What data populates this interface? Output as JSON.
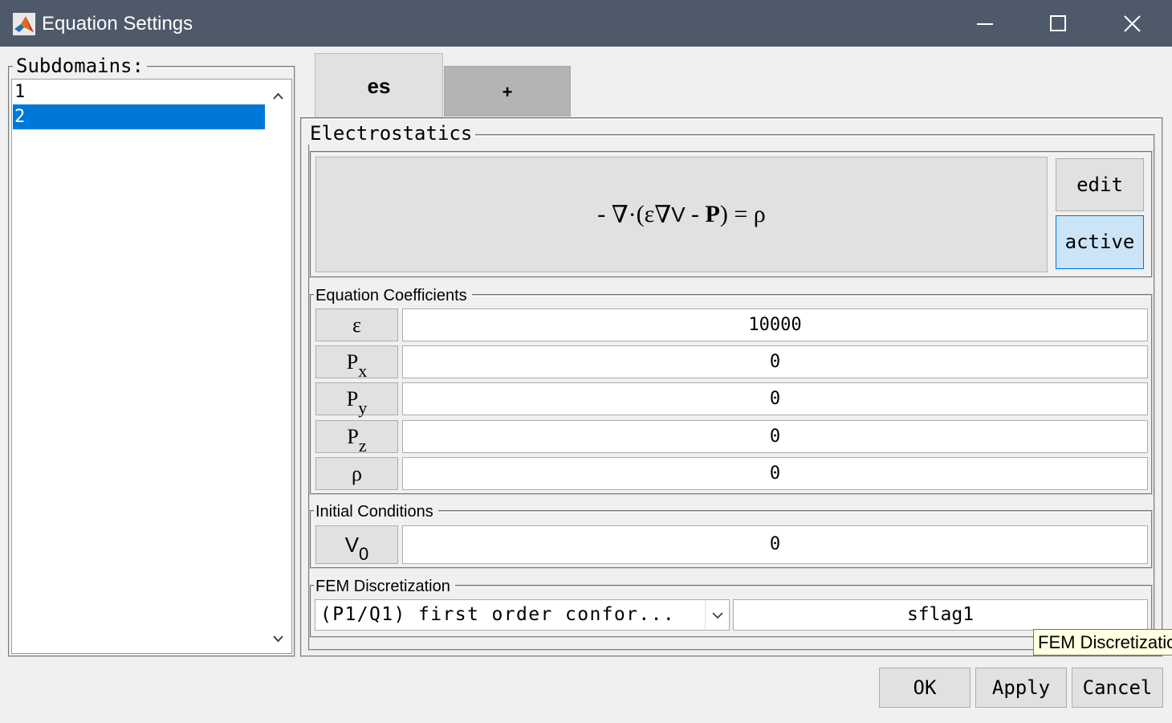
{
  "window": {
    "title": "Equation Settings",
    "icon": "matlab-logo-icon",
    "controls": [
      "minimize-icon",
      "maximize-icon",
      "close-icon"
    ]
  },
  "subdomains": {
    "label": "Subdomains:",
    "items": [
      "1",
      "2"
    ],
    "selected": "2"
  },
  "tabs": [
    {
      "label": "es",
      "active": true
    },
    {
      "label": "+",
      "active": false
    }
  ],
  "physics": {
    "label": "Electrostatics",
    "equation": {
      "minus": "-",
      "div": "∇·",
      "open": "(",
      "eps": "ε",
      "grad": "∇",
      "V": "V",
      "minus2": " - ",
      "P": "P",
      "close": ")",
      "equals": " = ",
      "rho": "ρ"
    },
    "edit_label": "edit",
    "active_label": "active"
  },
  "coefficients": {
    "label": "Equation Coefficients",
    "rows": [
      {
        "symbol": "ε",
        "sub": "",
        "value": "10000"
      },
      {
        "symbol": "P",
        "sub": "x",
        "value": "0"
      },
      {
        "symbol": "P",
        "sub": "y",
        "value": "0"
      },
      {
        "symbol": "P",
        "sub": "z",
        "value": "0"
      },
      {
        "symbol": "ρ",
        "sub": "",
        "value": "0"
      }
    ]
  },
  "initial_conditions": {
    "label": "Initial Conditions",
    "rows": [
      {
        "symbol": "V",
        "sub": "0",
        "value": "0"
      }
    ]
  },
  "fem": {
    "label": "FEM Discretization",
    "selected_option": "(P1/Q1) first order confor...",
    "shape_flag": "sflag1"
  },
  "tooltip": "FEM Discretization",
  "buttons": {
    "ok": "OK",
    "apply": "Apply",
    "cancel": "Cancel"
  },
  "colors": {
    "titlebar": "#4e5a6a",
    "selection": "#0078d7",
    "active_button": "#cce4f7",
    "tooltip_bg": "#ffffe1"
  }
}
